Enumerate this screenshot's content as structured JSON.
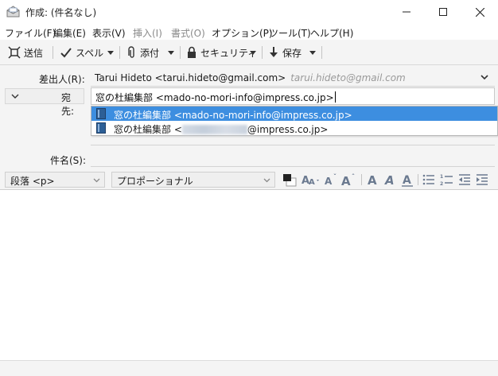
{
  "window": {
    "title": "作成: (件名なし)"
  },
  "menu": [
    {
      "label": "ファイル(F)",
      "enabled": true
    },
    {
      "label": "編集(E)",
      "enabled": true
    },
    {
      "label": "表示(V)",
      "enabled": true
    },
    {
      "label": "挿入(I)",
      "enabled": false
    },
    {
      "label": "書式(O)",
      "enabled": false
    },
    {
      "label": "オプション(P)",
      "enabled": true
    },
    {
      "label": "ツール(T)",
      "enabled": true
    },
    {
      "label": "ヘルプ(H)",
      "enabled": true
    }
  ],
  "toolbar": {
    "send_label": "送信",
    "spell_label": "スペル",
    "attach_label": "添付",
    "security_label": "セキュリティ",
    "save_label": "保存"
  },
  "header": {
    "from_label": "差出人(R):",
    "from_value": "Tarui Hideto <tarui.hideto@gmail.com>",
    "from_alias": "tarui.hideto@gmail.com",
    "to_type": "宛先:",
    "to_value": "窓の杜編集部 <mado-no-mori-info@impress.co.jp>",
    "subject_label": "件名(S):",
    "subject_value": ""
  },
  "autocomplete": [
    {
      "text": "窓の杜編集部 <mado-no-mori-info@impress.co.jp>",
      "selected": true
    },
    {
      "text_prefix": "窓の杜編集部 <",
      "text_suffix": "@impress.co.jp>",
      "selected": false
    }
  ],
  "format": {
    "paragraph": "段落 <p>",
    "font": "プロポーショナル"
  },
  "colors": {
    "selection": "#3d8ee0",
    "toolbar_bg": "#f4f4f4",
    "format_icon": "#6b7a90"
  }
}
